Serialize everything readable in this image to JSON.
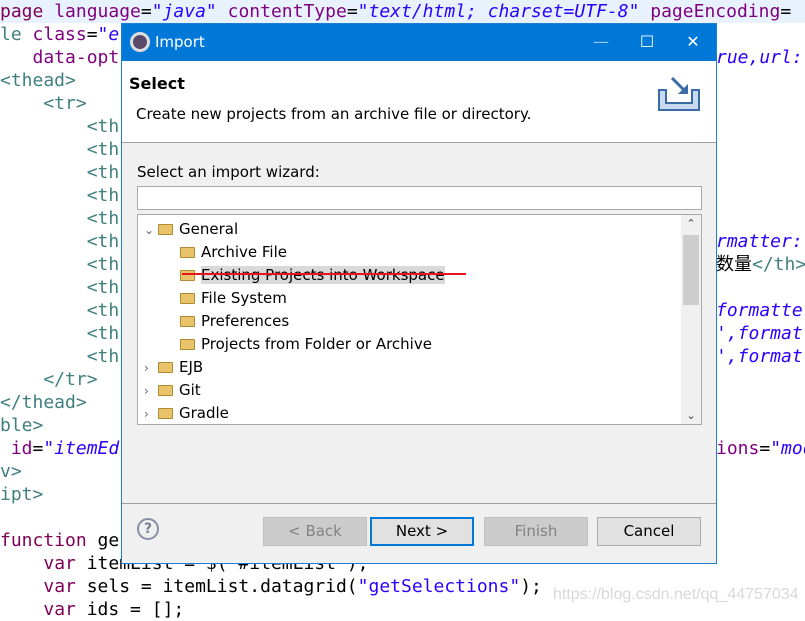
{
  "editor": {
    "lines": [
      {
        "hl": true,
        "segs": [
          [
            "page ",
            "k"
          ],
          [
            "language",
            "a"
          ],
          [
            "=",
            "p"
          ],
          [
            "\"java\"",
            "s"
          ],
          [
            " contentType",
            "a"
          ],
          [
            "=",
            "p"
          ],
          [
            "\"text/html; charset=UTF-8\"",
            "s"
          ],
          [
            " pageEncoding",
            "a"
          ],
          [
            "=",
            "p"
          ]
        ],
        "right": []
      },
      {
        "segs": [
          [
            "le ",
            "t"
          ],
          [
            "class",
            "a"
          ],
          [
            "=",
            "p"
          ],
          [
            "\"e",
            "s"
          ]
        ],
        "right": []
      },
      {
        "segs": [
          [
            "   data-opt",
            "a"
          ]
        ],
        "right": [
          [
            "rue,url:",
            "s"
          ]
        ]
      },
      {
        "segs": [
          [
            "<thead>",
            "t"
          ]
        ],
        "right": []
      },
      {
        "segs": [
          [
            "    <tr>",
            "t"
          ]
        ],
        "right": []
      },
      {
        "segs": [
          [
            "        <th",
            "t"
          ]
        ],
        "right": []
      },
      {
        "segs": [
          [
            "        <th",
            "t"
          ]
        ],
        "right": []
      },
      {
        "segs": [
          [
            "        <th",
            "t"
          ]
        ],
        "right": []
      },
      {
        "segs": [
          [
            "        <th",
            "t"
          ]
        ],
        "right": []
      },
      {
        "segs": [
          [
            "        <th",
            "t"
          ]
        ],
        "right": []
      },
      {
        "segs": [
          [
            "        <th",
            "t"
          ]
        ],
        "right": [
          [
            "rmatter:",
            "s"
          ]
        ]
      },
      {
        "segs": [
          [
            "        <th",
            "t"
          ]
        ],
        "right": [
          [
            "数量",
            "p"
          ],
          [
            "</th>",
            "t"
          ]
        ]
      },
      {
        "segs": [
          [
            "        <th",
            "t"
          ]
        ],
        "right": []
      },
      {
        "segs": [
          [
            "        <th",
            "t"
          ]
        ],
        "right": [
          [
            "formatte",
            "s"
          ]
        ]
      },
      {
        "segs": [
          [
            "        <th",
            "t"
          ]
        ],
        "right": [
          [
            "',format",
            "s"
          ]
        ]
      },
      {
        "segs": [
          [
            "        <th",
            "t"
          ]
        ],
        "right": [
          [
            "',format",
            "s"
          ]
        ]
      },
      {
        "segs": [
          [
            "    </tr>",
            "t"
          ]
        ],
        "right": []
      },
      {
        "segs": [
          [
            "</thead>",
            "t"
          ]
        ],
        "right": []
      },
      {
        "segs": [
          [
            "ble>",
            "t"
          ]
        ],
        "right": []
      },
      {
        "segs": [
          [
            " id",
            "a"
          ],
          [
            "=",
            "p"
          ],
          [
            "\"itemEd",
            "s"
          ]
        ],
        "right": [
          [
            "ions",
            "a"
          ],
          [
            "=",
            "p"
          ],
          [
            "\"mod",
            "s"
          ]
        ]
      },
      {
        "segs": [
          [
            "v>",
            "t"
          ]
        ],
        "right": []
      },
      {
        "segs": [
          [
            "ipt>",
            "t"
          ]
        ],
        "right": []
      },
      {
        "segs": [],
        "right": []
      },
      {
        "segs": [
          [
            "function",
            "k"
          ],
          [
            " ge",
            "p"
          ]
        ],
        "right": []
      },
      {
        "segs": [
          [
            "    ",
            "p"
          ],
          [
            "var",
            "k"
          ],
          [
            " itemList = $(\"#itemList\");",
            "p"
          ]
        ],
        "right": []
      },
      {
        "segs": [
          [
            "    ",
            "p"
          ],
          [
            "var",
            "k"
          ],
          [
            " sels = itemList.datagrid(",
            "p"
          ],
          [
            "\"getSelections\"",
            "q"
          ],
          [
            ");",
            "p"
          ]
        ],
        "right": []
      },
      {
        "segs": [
          [
            "    ",
            "p"
          ],
          [
            "var",
            "k"
          ],
          [
            " ids = [];",
            "p"
          ]
        ],
        "right": []
      }
    ],
    "watermark": "https://blog.csdn.net/qq_44757034"
  },
  "dialog": {
    "title": "Import",
    "icon": "eclipse-icon",
    "accent": "#0078d7",
    "header_title": "Select",
    "header_desc": "Create new projects from an archive file or directory.",
    "wizard_label": "Select an import wizard:",
    "search_value": "",
    "tree": [
      {
        "label": "General",
        "level": 0,
        "expanded": true,
        "icon": "folder-open-icon"
      },
      {
        "label": "Archive File",
        "level": 1,
        "icon": "archive-icon"
      },
      {
        "label": "Existing Projects into Workspace",
        "level": 1,
        "icon": "project-folder-icon",
        "selected": true
      },
      {
        "label": "File System",
        "level": 1,
        "icon": "folder-icon"
      },
      {
        "label": "Preferences",
        "level": 1,
        "icon": "preferences-icon"
      },
      {
        "label": "Projects from Folder or Archive",
        "level": 1,
        "icon": "folder-icon"
      },
      {
        "label": "EJB",
        "level": 0,
        "expanded": false,
        "icon": "folder-open-icon"
      },
      {
        "label": "Git",
        "level": 0,
        "expanded": false,
        "icon": "folder-open-icon"
      },
      {
        "label": "Gradle",
        "level": 0,
        "expanded": false,
        "icon": "folder-open-icon"
      }
    ],
    "buttons": {
      "back": "< Back",
      "next": "Next >",
      "finish": "Finish",
      "cancel": "Cancel"
    },
    "help": "?"
  }
}
